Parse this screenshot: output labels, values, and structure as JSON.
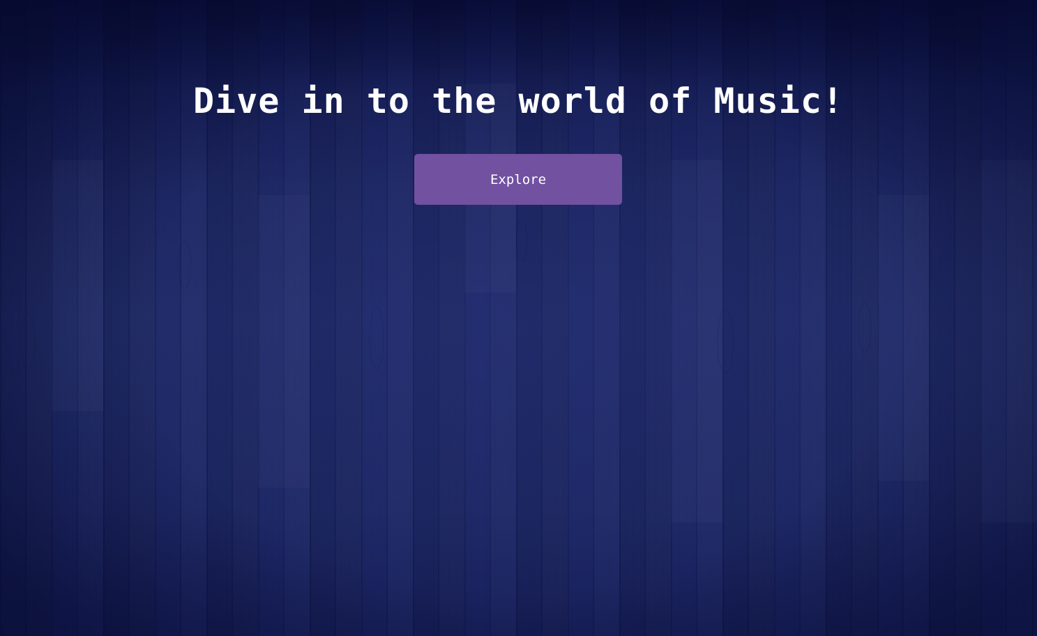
{
  "hero": {
    "title": "Dive in to the world of Music!",
    "explore_label": "Explore"
  },
  "colors": {
    "background": "#1b2562",
    "button": "#7151a0",
    "text": "#ffffff"
  }
}
